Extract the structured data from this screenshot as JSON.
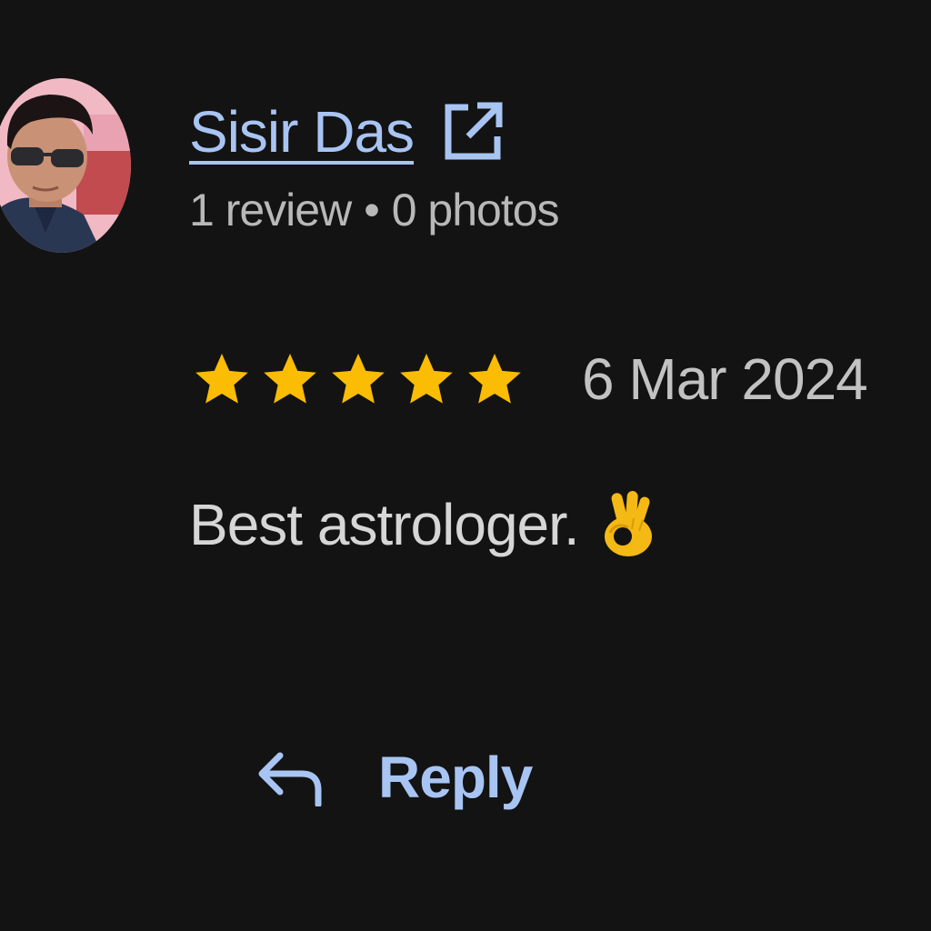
{
  "review": {
    "reviewer": {
      "name": "Sisir Das",
      "review_count": "1 review",
      "separator": "•",
      "photo_count": "0 photos",
      "avatar": "profile-photo",
      "link_icon": "external-link-icon"
    },
    "rating": {
      "stars": 5,
      "max_stars": 5,
      "star_icon": "star-icon",
      "star_color": "#FBBC04"
    },
    "date": "6 Mar 2024",
    "text": "Best astrologer.",
    "emoji": "ok-hand-emoji",
    "reply": {
      "label": "Reply",
      "icon": "reply-arrow-icon"
    }
  },
  "colors": {
    "background": "#131313",
    "link": "#a8c4f2",
    "secondary_text": "#b8b8b8",
    "primary_text": "#d6d6d6"
  }
}
